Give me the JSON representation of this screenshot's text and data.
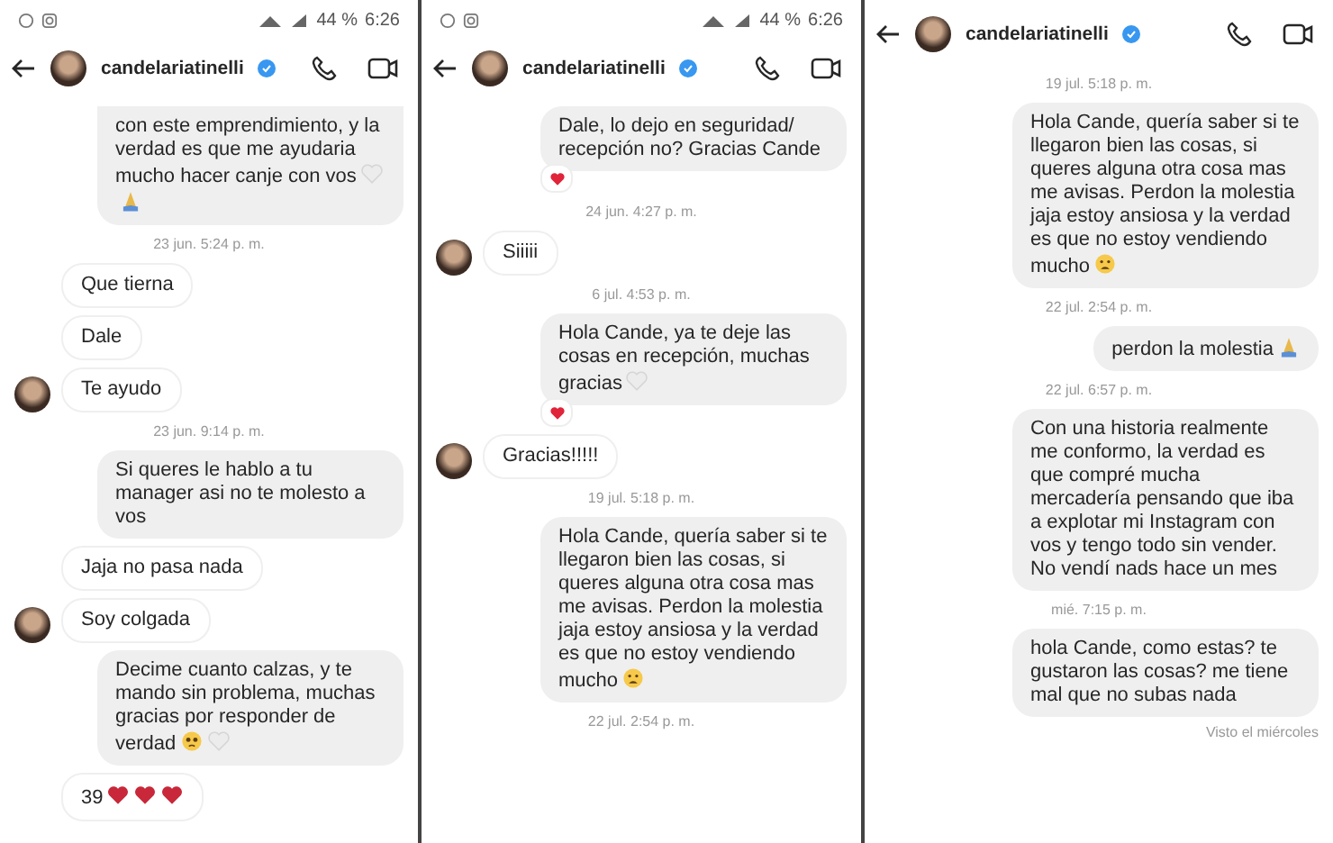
{
  "panels": [
    {
      "status_bar": {
        "battery": "44 %",
        "time": "6:26"
      },
      "header": {
        "username": "candelariatinelli",
        "verified": true
      },
      "messages": [
        {
          "kind": "sent",
          "text": "con este emprendimiento, y la verdad es que me ayudaria mucho hacer canje con vos",
          "icons": [
            {
              "kind": "white-heart"
            },
            {
              "kind": "pray"
            }
          ],
          "cut_top": true
        },
        {
          "kind": "time",
          "text": "23 jun. 5:24 p. m."
        },
        {
          "kind": "received",
          "text": "Que tierna",
          "avatar": false
        },
        {
          "kind": "received",
          "text": "Dale",
          "avatar": false
        },
        {
          "kind": "received",
          "text": "Te ayudo",
          "avatar": true
        },
        {
          "kind": "time",
          "text": "23 jun. 9:14 p. m."
        },
        {
          "kind": "sent",
          "text": "Si queres le hablo a tu manager asi no te molesto a vos"
        },
        {
          "kind": "received",
          "text": "Jaja no pasa nada",
          "avatar": false
        },
        {
          "kind": "received",
          "text": "Soy colgada",
          "avatar": true
        },
        {
          "kind": "sent",
          "text": "Decime cuanto calzas, y te mando sin problema, muchas gracias por responder de verdad",
          "icons": [
            {
              "kind": "pleading"
            },
            {
              "kind": "white-heart"
            }
          ]
        },
        {
          "kind": "received",
          "text": "39",
          "avatar": false,
          "icons": [
            {
              "kind": "heart"
            },
            {
              "kind": "heart"
            },
            {
              "kind": "heart"
            }
          ]
        }
      ]
    },
    {
      "status_bar": {
        "battery": "44 %",
        "time": "6:26"
      },
      "header": {
        "username": "candelariatinelli",
        "verified": true
      },
      "messages": [
        {
          "kind": "sent",
          "text": "Dale, lo dejo en seguridad/ recepción no? Gracias Cande",
          "reaction": true
        },
        {
          "kind": "time",
          "text": "24 jun. 4:27 p. m."
        },
        {
          "kind": "received",
          "text": "Siiiii",
          "avatar": true
        },
        {
          "kind": "time",
          "text": "6 jul. 4:53 p. m."
        },
        {
          "kind": "sent",
          "text": "Hola Cande, ya te deje las cosas en recepción, muchas gracias",
          "icons": [
            {
              "kind": "white-heart"
            }
          ],
          "reaction": true
        },
        {
          "kind": "received",
          "text": "Gracias!!!!!",
          "avatar": true
        },
        {
          "kind": "time",
          "text": "19 jul. 5:18 p. m."
        },
        {
          "kind": "sent",
          "text": "Hola Cande, quería saber si te llegaron bien las cosas, si queres alguna otra cosa mas me avisas. Perdon la molestia jaja estoy ansiosa y la verdad es que no estoy vendiendo mucho",
          "icons": [
            {
              "kind": "worried"
            }
          ]
        },
        {
          "kind": "time",
          "text": "22 jul. 2:54 p. m."
        }
      ]
    },
    {
      "header": {
        "username": "candelariatinelli",
        "verified": true
      },
      "messages": [
        {
          "kind": "time",
          "text": "19 jul. 5:18 p. m."
        },
        {
          "kind": "sent",
          "text": "Hola Cande, quería saber si te llegaron bien las cosas, si queres alguna otra cosa mas me avisas. Perdon la molestia jaja estoy ansiosa y la verdad es que no estoy vendiendo mucho",
          "icons": [
            {
              "kind": "worried"
            }
          ]
        },
        {
          "kind": "time",
          "text": "22 jul. 2:54 p. m."
        },
        {
          "kind": "sent",
          "text": "perdon la molestia",
          "icons": [
            {
              "kind": "pray"
            }
          ]
        },
        {
          "kind": "time",
          "text": "22 jul. 6:57 p. m."
        },
        {
          "kind": "sent",
          "text": "Con una historia realmente me conformo, la verdad es que compré mucha mercadería pensando que iba a explotar mi Instagram con vos y tengo todo sin vender. No vendí nads hace un mes"
        },
        {
          "kind": "time",
          "text": "mié. 7:15 p. m."
        },
        {
          "kind": "sent",
          "text": "hola Cande, como estas? te gustaron las cosas? me tiene mal que no subas nada"
        },
        {
          "kind": "seen",
          "text": "Visto el miércoles"
        }
      ]
    }
  ]
}
